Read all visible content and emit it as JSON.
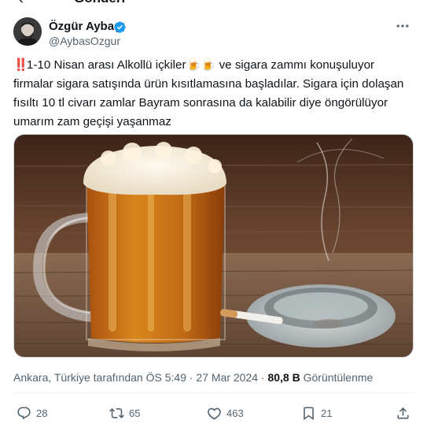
{
  "header": {
    "title": "Gönderi",
    "back_icon": "arrow-left-icon"
  },
  "author": {
    "display_name": "Özgür Aybaş",
    "handle": "@AybasOzgur",
    "verified_icon": "verified-badge-icon",
    "verified_color": "#1d9bf0"
  },
  "tweet": {
    "emoji_prefix": "‼️",
    "text_line1": "1-10 Nisan arası Alkollü içkiler",
    "emoji_beers": "🍺🍺",
    "text_line1_rest": " ve sigara zammı konuşuluyor",
    "text_rest": "firmalar sigara satışında ürün kısıtlamasına başladılar. Sigara için dolaşan fısıltı 10 tl civarı zamlar Bayram sonrasına da kalabilir diye öngörülüyor umarım zam geçişi yaşanmaz",
    "media_icon": "beer-and-cigarette-photo"
  },
  "meta": {
    "location_time": "Ankara, Türkiye tarafından ÖS 5:49 · 27 Mar 2024 · ",
    "views_count": "80,8 B",
    "views_label": " Görüntülenme"
  },
  "actions": {
    "replies": "28",
    "reposts": "65",
    "likes": "463",
    "bookmarks": "21",
    "reply_icon": "reply-icon",
    "repost_icon": "repost-icon",
    "like_icon": "heart-icon",
    "bookmark_icon": "bookmark-icon",
    "share_icon": "share-icon"
  },
  "colors": {
    "text": "#0f1419",
    "secondary": "#536471",
    "accent": "#1d9bf0"
  }
}
